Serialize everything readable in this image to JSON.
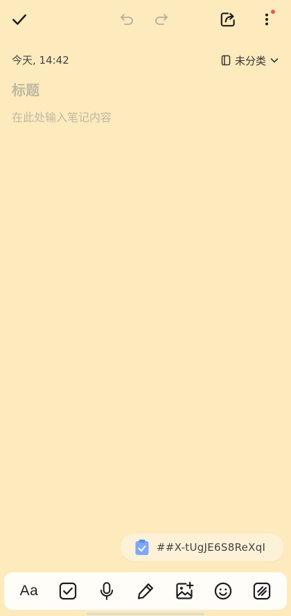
{
  "toolbar": {
    "done_icon": "check-icon",
    "undo_icon": "undo-icon",
    "redo_icon": "redo-icon",
    "share_icon": "share-icon",
    "more_icon": "more-vertical-icon",
    "notification_dot_color": "#f0554b"
  },
  "note": {
    "timestamp": "今天, 14:42",
    "category_label": "未分类",
    "title_placeholder": "标题",
    "body_placeholder": "在此处输入笔记内容"
  },
  "clipboard_chip": {
    "icon": "clipboard-check-icon",
    "text": "##X-tUgJE6S8ReXqI"
  },
  "bottom_tools": [
    {
      "name": "text-format",
      "label": "Aa"
    },
    {
      "name": "checklist",
      "icon": "checkbox-icon"
    },
    {
      "name": "voice",
      "icon": "microphone-icon"
    },
    {
      "name": "draw",
      "icon": "pen-icon"
    },
    {
      "name": "image",
      "icon": "add-image-icon"
    },
    {
      "name": "emoji",
      "icon": "smiley-icon"
    },
    {
      "name": "style",
      "icon": "hatch-icon"
    }
  ],
  "colors": {
    "background": "#fdebbd",
    "placeholder": "#bfb8a2",
    "accent_blue": "#7ea9f5"
  }
}
